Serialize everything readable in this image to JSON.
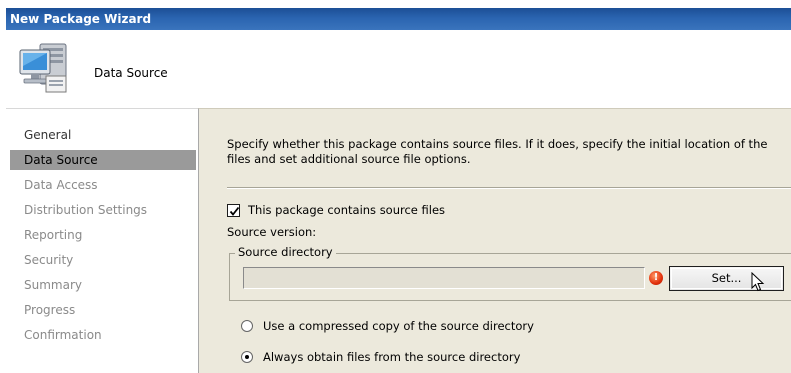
{
  "window": {
    "title": "New Package Wizard"
  },
  "header": {
    "page_title": "Data Source",
    "icon": "computer-package-icon"
  },
  "nav": {
    "items": [
      {
        "label": "General",
        "state": "normal"
      },
      {
        "label": "Data Source",
        "state": "selected"
      },
      {
        "label": "Data Access",
        "state": "disabled"
      },
      {
        "label": "Distribution Settings",
        "state": "disabled"
      },
      {
        "label": "Reporting",
        "state": "disabled"
      },
      {
        "label": "Security",
        "state": "disabled"
      },
      {
        "label": "Summary",
        "state": "disabled"
      },
      {
        "label": "Progress",
        "state": "disabled"
      },
      {
        "label": "Confirmation",
        "state": "disabled"
      }
    ]
  },
  "content": {
    "description": "Specify whether this package contains source files. If it does, specify the initial location of the files and set additional source file options.",
    "contains_source": {
      "label": "This package contains source files",
      "checked": true
    },
    "source_version_label": "Source version:",
    "source_directory": {
      "legend": "Source directory",
      "value": "",
      "warning_icon": "error-icon",
      "set_button": "Set..."
    },
    "options": [
      {
        "label": "Use a compressed copy of the source directory",
        "selected": false
      },
      {
        "label": "Always obtain files from the source directory",
        "selected": true
      }
    ]
  },
  "colors": {
    "title_bar": "#2a64b0",
    "nav_selected": "#9a9a9a",
    "panel_background": "#ece9dc",
    "warning": "#e2300c"
  }
}
